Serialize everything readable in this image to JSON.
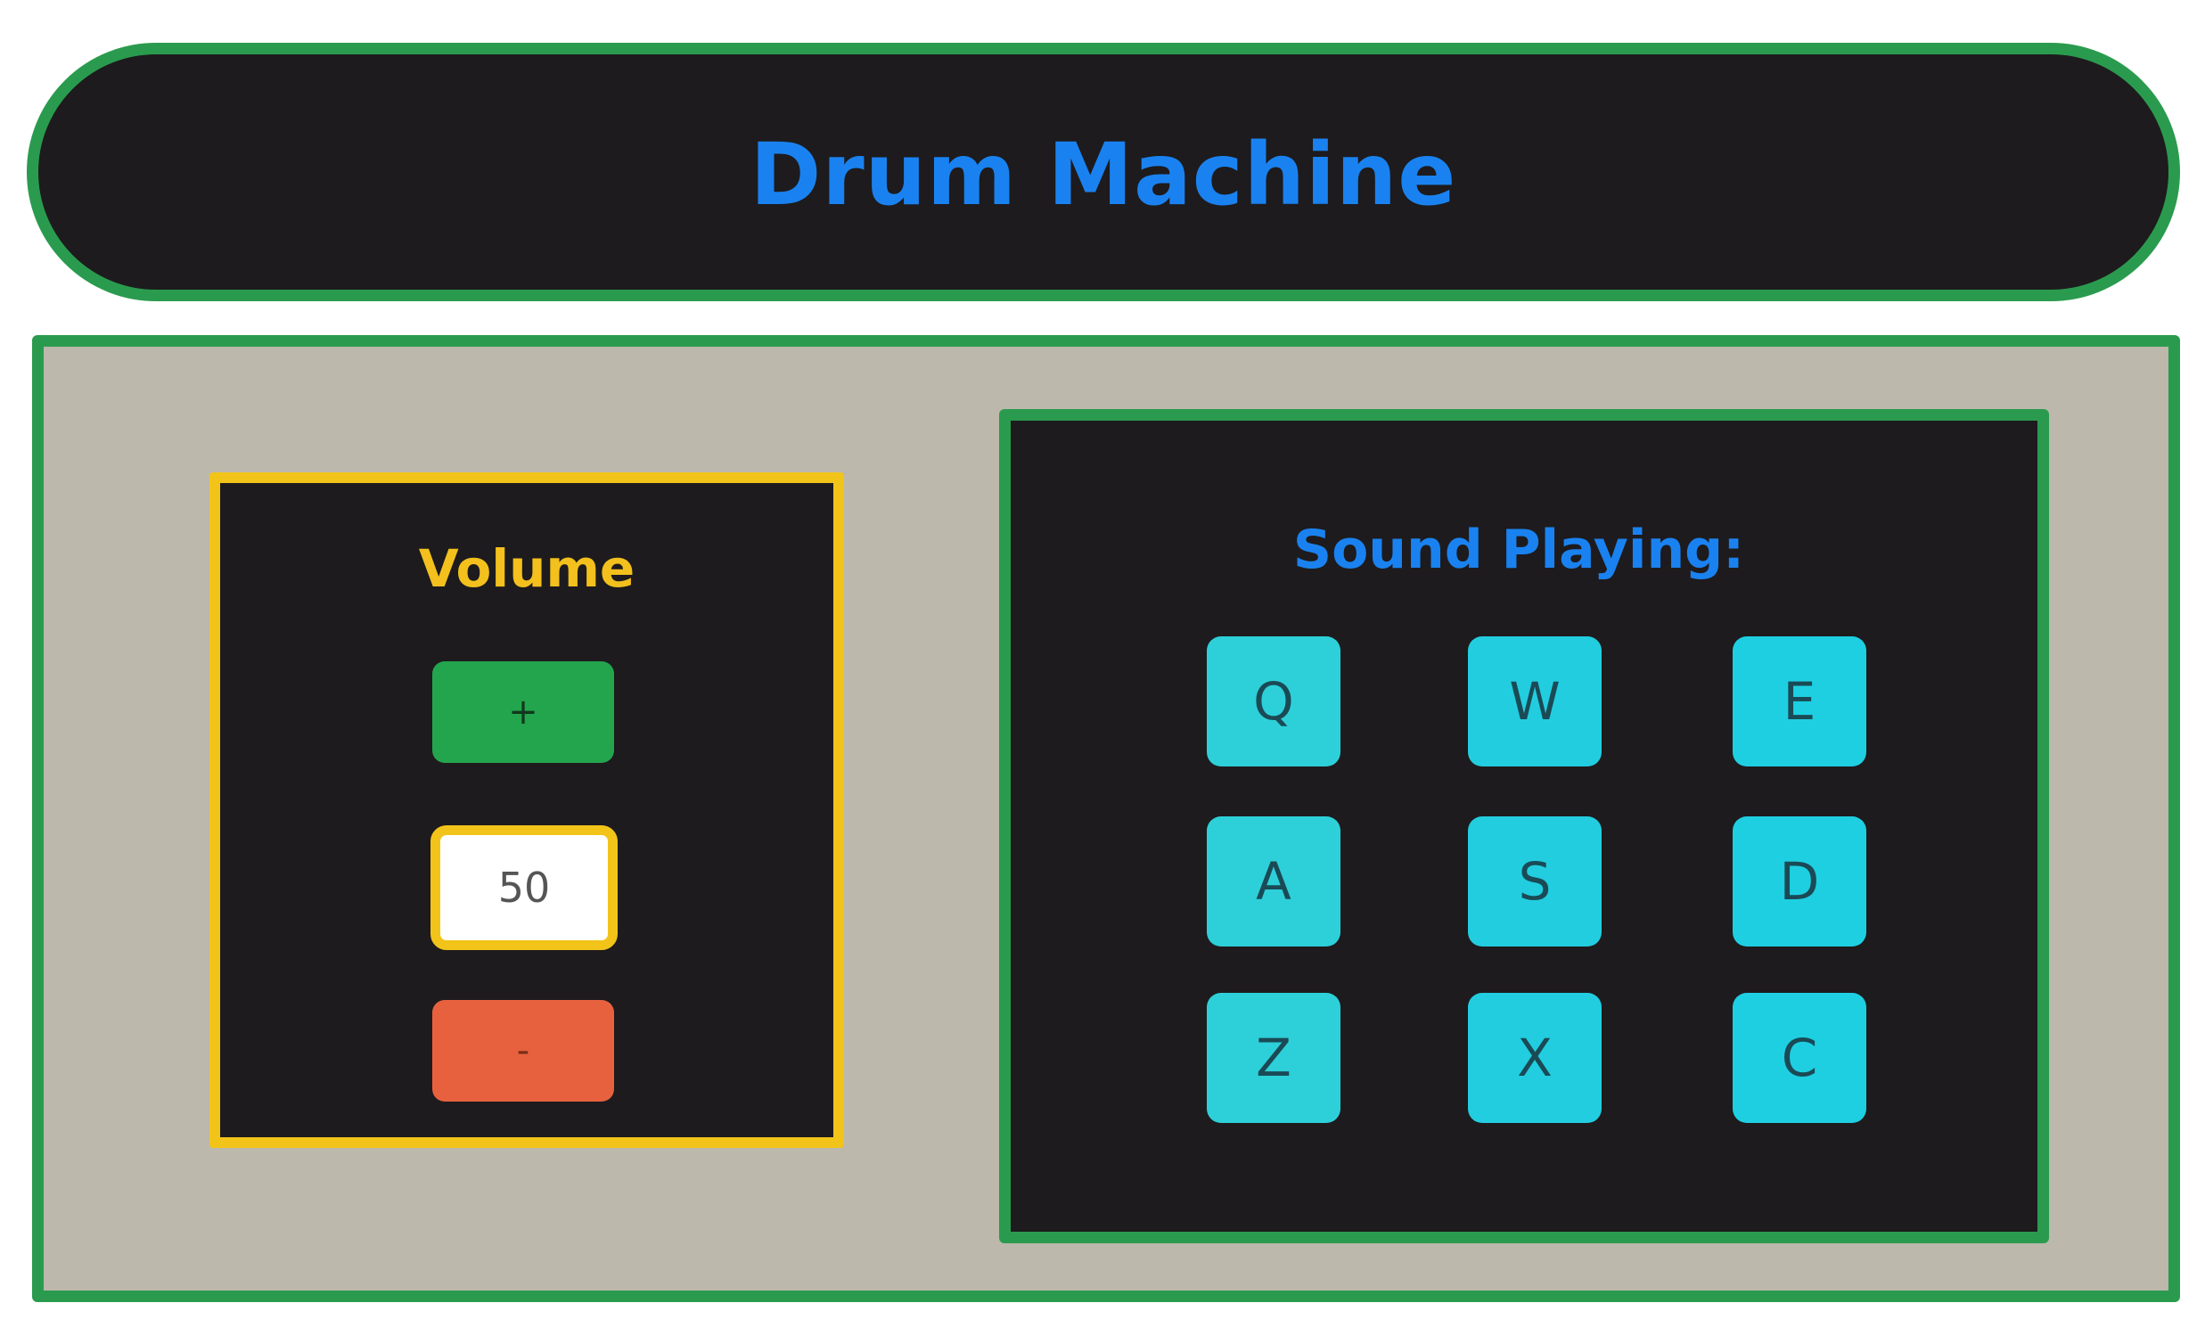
{
  "header": {
    "title": "Drum Machine"
  },
  "volume": {
    "title": "Volume",
    "increase_label": "+",
    "value": "50",
    "decrease_label": "-"
  },
  "drum_pads": {
    "sound_label": "Sound Playing:",
    "current_sound": "",
    "pads": [
      "Q",
      "W",
      "E",
      "A",
      "S",
      "D",
      "Z",
      "X",
      "C"
    ]
  },
  "colors": {
    "background": "#ffffff",
    "panel": "#bcb8ac",
    "dark": "#1d1b1d",
    "green_border": "#2a9b4e",
    "yellow_border": "#f2c419",
    "title_blue": "#1a82f0",
    "volume_yellow": "#f3c01d",
    "plus_green": "#23a54d",
    "minus_red": "#e7613f",
    "pad_cyan": "#1ecfe2"
  },
  "icons": {
    "increase": "plus-sign",
    "decrease": "minus-sign"
  }
}
